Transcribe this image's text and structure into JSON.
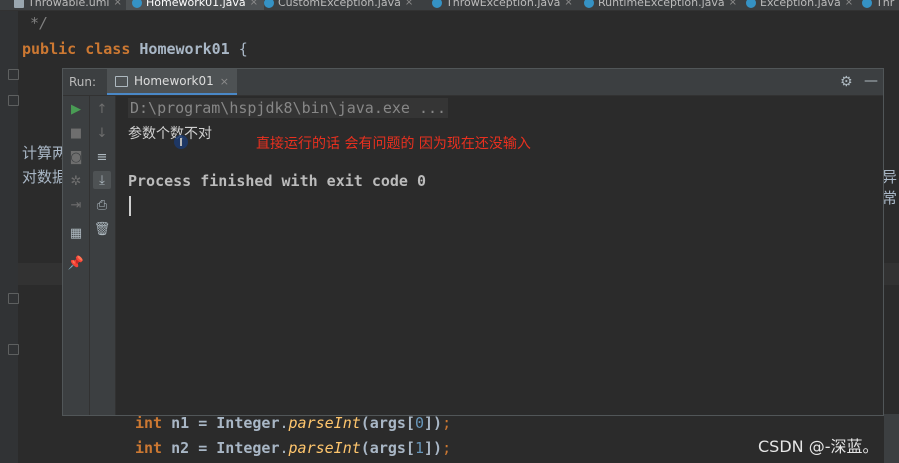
{
  "tabs": [
    {
      "label": "Throwable.uml",
      "active": false
    },
    {
      "label": "Homework01.java",
      "active": true
    },
    {
      "label": "CustomException.java",
      "active": false
    },
    {
      "label": "ThrowException.java",
      "active": false
    },
    {
      "label": "RuntimeException.java",
      "active": false
    },
    {
      "label": "Exception.java",
      "active": false
    },
    {
      "label": "Thr",
      "active": false
    }
  ],
  "editor": {
    "comment_end": "*/",
    "class_kw1": "public",
    "class_kw2": "class",
    "class_name": "Homework01",
    "class_brace": "{",
    "left_fragment_1": "计算两",
    "left_fragment_2": "对数据",
    "right_fragment": "异常",
    "line_n1": {
      "type": "int",
      "var": "n1",
      "eq": "=",
      "cls": "Integer",
      "method": "parseInt",
      "args_open": "(args[",
      "index": "0",
      "args_close": "])",
      "semi": ";"
    },
    "line_n2": {
      "type": "int",
      "var": "n2",
      "eq": "=",
      "cls": "Integer",
      "method": "parseInt",
      "args_open": "(args[",
      "index": "1",
      "args_close": "])",
      "semi": ";"
    }
  },
  "run": {
    "label": "Run:",
    "tab_label": "Homework01",
    "tab_close": "×",
    "settings_icon": "⚙",
    "minimize_icon": "—",
    "console": {
      "command": "D:\\program\\hspjdk8\\bin\\java.exe ...",
      "error_output": "参数个数不对",
      "annotation": "直接运行的话 会有问题的 因为现在还没输入",
      "finished": "Process finished with exit code 0"
    },
    "toolbar_icons": [
      "rerun-icon",
      "stop-icon",
      "screenshot-icon",
      "settings-sub-icon",
      "exit-icon",
      "layout-icon",
      "pin-icon",
      "up-icon",
      "down-icon",
      "soft-wrap-icon",
      "scroll-end-icon",
      "print-icon",
      "trash-icon"
    ]
  },
  "watermark": "CSDN @-深蓝。",
  "colors": {
    "background": "#2b2b2b",
    "keyword": "#cc7832",
    "annotation_red": "#e8301f",
    "accent_blue": "#4a88c7",
    "run_green": "#499c54"
  }
}
